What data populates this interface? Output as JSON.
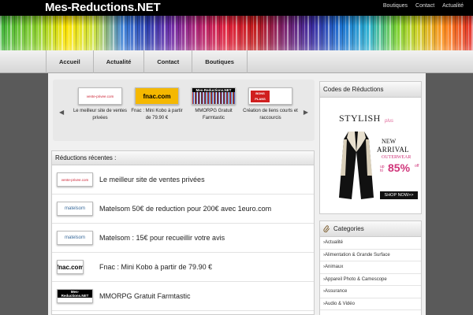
{
  "header": {
    "site_title": "Mes-Reductions.NET",
    "top_links": [
      "Boutiques",
      "Contact",
      "Actualité"
    ]
  },
  "nav": {
    "items": [
      "Accueil",
      "Actualité",
      "Contact",
      "Boutiques"
    ]
  },
  "slider": {
    "prev_arrow": "◀",
    "next_arrow": "▶",
    "slides": [
      {
        "logo_text": "vente-privee.com",
        "caption": "Le meilleur site de ventes privées"
      },
      {
        "logo_text": "fnac.com",
        "caption": "Fnac : Mini Kobo à partir de 79.90 €"
      },
      {
        "logo_text": "Mes-Reductions.NET",
        "caption": "MMORPG Gratuit Farmtastic"
      },
      {
        "logo_text": "BONS PLANS",
        "caption": "Création de liens courts et raccourcis"
      }
    ]
  },
  "recent": {
    "title": "Réductions récentes :",
    "items": [
      {
        "logo_text": "vente-privee.com",
        "text": "Le meilleur site de ventes privées"
      },
      {
        "logo_text": "matelsom",
        "text": "Matelsom 50€ de reduction pour 200€ avec 1euro.com"
      },
      {
        "logo_text": "matelsom",
        "text": "Matelsom : 15€ pour recueillir votre avis"
      },
      {
        "logo_text": "fnac.com",
        "text": "Fnac : Mini Kobo à partir de 79.90 €"
      },
      {
        "logo_text": "Mes-Reductions.NET",
        "text": "MMORPG Gratuit Farmtastic"
      }
    ]
  },
  "sidebar": {
    "codes_title": "Codes de Réductions",
    "ad": {
      "brand": "STYLISH",
      "brand_sub": "plus",
      "line1": "NEW",
      "line2": "ARRIVAL",
      "line3": "OUTERWEAR",
      "upto": "up to",
      "percent": "85%",
      "off": "off",
      "cta": "SHOP NOW>>"
    },
    "categories_title": "Categories",
    "categories": [
      "›Actualité",
      "›Alimentation & Grande Surface",
      "›Animaux",
      "›Appareil Photo & Camescope",
      "›Assurance",
      "›Audio & Vidéo"
    ]
  },
  "colors": {
    "accent_pink": "#d0357a",
    "fnac_yellow": "#f5b800"
  }
}
